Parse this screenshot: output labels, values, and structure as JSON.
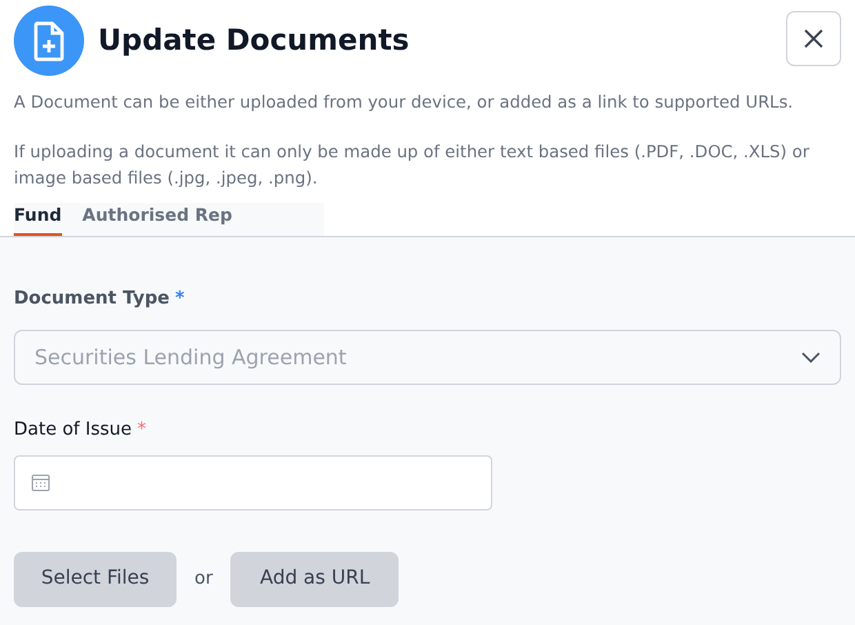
{
  "dialog": {
    "title": "Update Documents"
  },
  "intro": [
    "A Document can be either uploaded from your device, or added as a link to supported URLs.",
    "If uploading a document it can only be made up of either text based files (.PDF, .DOC, .XLS) or image based files (.jpg, .jpeg, .png)."
  ],
  "tabs": [
    {
      "label": "Fund",
      "selected": true
    },
    {
      "label": "Authorised Rep",
      "selected": false
    }
  ],
  "fields": [
    {
      "kind": "select",
      "label": "Document Type",
      "required": "*",
      "color": "#3b82f6",
      "placeholder": "Securities Lending Agreement"
    },
    {
      "kind": "date",
      "label": "Date of Issue",
      "required": "*",
      "color": "#f87171"
    }
  ],
  "actions": {
    "select_files": "Select Files",
    "separator": "or",
    "add_url": "Add as URL"
  }
}
